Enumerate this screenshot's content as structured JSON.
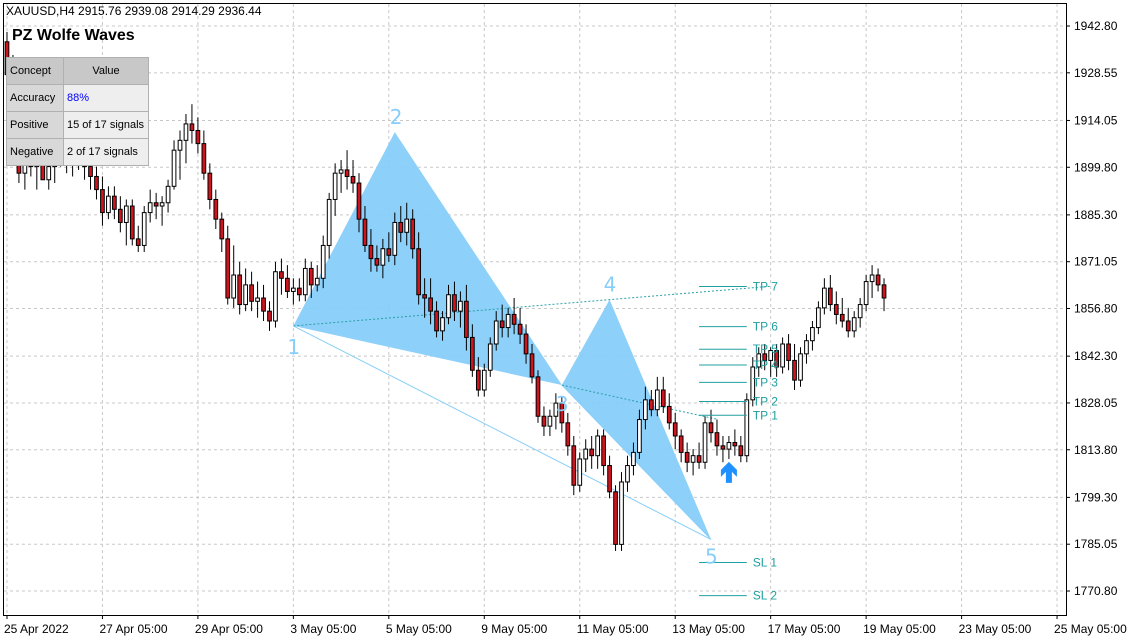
{
  "symbol_header": "XAUUSD,H4  2915.76 2939.08 2914.29 2936.44",
  "panel": {
    "title": "PZ Wolfe Waves",
    "headers": [
      "Concept",
      "Value"
    ],
    "rows": [
      {
        "concept": "Accuracy",
        "value": "88%"
      },
      {
        "concept": "Positive",
        "value": "15 of 17 signals"
      },
      {
        "concept": "Negative",
        "value": "2 of 17 signals"
      }
    ]
  },
  "colors": {
    "bull_candle": "#000000",
    "bear_candle": "#d0141e",
    "wave_fill": "#87cefa",
    "wave_label": "#87cefa",
    "target_line": "#20a0a0",
    "arrow": "#1e90ff",
    "grid": "#c8c8c8"
  },
  "chart_data": {
    "type": "candlestick",
    "ylim": [
      1763.5,
      1949.5
    ],
    "y_ticks": [
      "1942.80",
      "1928.55",
      "1914.05",
      "1899.80",
      "1885.30",
      "1871.05",
      "1856.80",
      "1842.30",
      "1828.05",
      "1813.80",
      "1799.30",
      "1785.05",
      "1770.80"
    ],
    "y_tick_values": [
      1942.8,
      1928.55,
      1914.05,
      1899.8,
      1885.3,
      1871.05,
      1856.8,
      1842.3,
      1828.05,
      1813.8,
      1799.3,
      1785.05,
      1770.8
    ],
    "x_ticks": [
      "25 Apr 2022",
      "27 Apr 05:00",
      "29 Apr 05:00",
      "3 May 05:00",
      "5 May 05:00",
      "9 May 05:00",
      "11 May 05:00",
      "13 May 05:00",
      "17 May 05:00",
      "19 May 05:00",
      "23 May 05:00",
      "25 May 05:00"
    ],
    "x_tick_bars": [
      0,
      16,
      32,
      48,
      64,
      80,
      96,
      112,
      128,
      144,
      160,
      176
    ],
    "bar_count": 178,
    "candles": [
      [
        1938,
        1941,
        1925,
        1928
      ],
      [
        1928,
        1934,
        1920,
        1930
      ],
      [
        1930,
        1932,
        1895,
        1898
      ],
      [
        1898,
        1906,
        1893,
        1902
      ],
      [
        1902,
        1909,
        1897,
        1900
      ],
      [
        1900,
        1905,
        1893,
        1904
      ],
      [
        1904,
        1910,
        1899,
        1896
      ],
      [
        1896,
        1903,
        1893,
        1900
      ],
      [
        1900,
        1907,
        1895,
        1905
      ],
      [
        1905,
        1908,
        1900,
        1903
      ],
      [
        1903,
        1907,
        1898,
        1901
      ],
      [
        1901,
        1906,
        1897,
        1905
      ],
      [
        1905,
        1910,
        1899,
        1902
      ],
      [
        1902,
        1906,
        1896,
        1900
      ],
      [
        1900,
        1903,
        1893,
        1897
      ],
      [
        1897,
        1900,
        1890,
        1893
      ],
      [
        1893,
        1897,
        1882,
        1886
      ],
      [
        1886,
        1894,
        1884,
        1891
      ],
      [
        1891,
        1894,
        1884,
        1887
      ],
      [
        1887,
        1891,
        1880,
        1883
      ],
      [
        1883,
        1890,
        1876,
        1888
      ],
      [
        1888,
        1890,
        1876,
        1878
      ],
      [
        1878,
        1882,
        1874,
        1876
      ],
      [
        1876,
        1888,
        1874,
        1886
      ],
      [
        1886,
        1893,
        1883,
        1889
      ],
      [
        1889,
        1892,
        1884,
        1888
      ],
      [
        1888,
        1891,
        1882,
        1889
      ],
      [
        1889,
        1896,
        1886,
        1894
      ],
      [
        1894,
        1908,
        1893,
        1905
      ],
      [
        1905,
        1911,
        1896,
        1908
      ],
      [
        1908,
        1916,
        1901,
        1913
      ],
      [
        1913,
        1919,
        1907,
        1911
      ],
      [
        1911,
        1915,
        1904,
        1907
      ],
      [
        1907,
        1911,
        1896,
        1898
      ],
      [
        1898,
        1901,
        1887,
        1890
      ],
      [
        1890,
        1893,
        1881,
        1884
      ],
      [
        1884,
        1886,
        1874,
        1878
      ],
      [
        1878,
        1882,
        1858,
        1860
      ],
      [
        1860,
        1876,
        1857,
        1867
      ],
      [
        1867,
        1871,
        1855,
        1858
      ],
      [
        1858,
        1869,
        1856,
        1864
      ],
      [
        1864,
        1868,
        1856,
        1859
      ],
      [
        1859,
        1865,
        1854,
        1860
      ],
      [
        1860,
        1864,
        1853,
        1856
      ],
      [
        1856,
        1859,
        1850,
        1853
      ],
      [
        1853,
        1871,
        1851,
        1868
      ],
      [
        1868,
        1872,
        1861,
        1866
      ],
      [
        1866,
        1870,
        1860,
        1862
      ],
      [
        1862,
        1866,
        1858,
        1863
      ],
      [
        1863,
        1866,
        1859,
        1861
      ],
      [
        1861,
        1872,
        1859,
        1869
      ],
      [
        1869,
        1871,
        1860,
        1864
      ],
      [
        1864,
        1870,
        1862,
        1866
      ],
      [
        1866,
        1879,
        1863,
        1876
      ],
      [
        1876,
        1892,
        1872,
        1890
      ],
      [
        1890,
        1901,
        1885,
        1898
      ],
      [
        1898,
        1902,
        1892,
        1899
      ],
      [
        1899,
        1905,
        1893,
        1897
      ],
      [
        1897,
        1902,
        1892,
        1895
      ],
      [
        1895,
        1898,
        1880,
        1884
      ],
      [
        1884,
        1888,
        1874,
        1876
      ],
      [
        1876,
        1881,
        1868,
        1872
      ],
      [
        1872,
        1876,
        1868,
        1870
      ],
      [
        1870,
        1878,
        1866,
        1875
      ],
      [
        1875,
        1880,
        1871,
        1873
      ],
      [
        1873,
        1886,
        1870,
        1883
      ],
      [
        1883,
        1888,
        1877,
        1880
      ],
      [
        1880,
        1889,
        1876,
        1884
      ],
      [
        1884,
        1887,
        1872,
        1875
      ],
      [
        1875,
        1880,
        1858,
        1861
      ],
      [
        1861,
        1866,
        1854,
        1860
      ],
      [
        1860,
        1866,
        1852,
        1856
      ],
      [
        1856,
        1859,
        1848,
        1850
      ],
      [
        1850,
        1856,
        1847,
        1854
      ],
      [
        1854,
        1864,
        1852,
        1861
      ],
      [
        1861,
        1865,
        1853,
        1856
      ],
      [
        1856,
        1862,
        1851,
        1859
      ],
      [
        1859,
        1864,
        1844,
        1848
      ],
      [
        1848,
        1852,
        1836,
        1838
      ],
      [
        1838,
        1842,
        1830,
        1832
      ],
      [
        1832,
        1840,
        1830,
        1838
      ],
      [
        1838,
        1848,
        1836,
        1846
      ],
      [
        1846,
        1856,
        1844,
        1853
      ],
      [
        1853,
        1858,
        1848,
        1851
      ],
      [
        1851,
        1857,
        1848,
        1855
      ],
      [
        1855,
        1860,
        1849,
        1852
      ],
      [
        1852,
        1857,
        1846,
        1849
      ],
      [
        1849,
        1852,
        1840,
        1843
      ],
      [
        1843,
        1846,
        1834,
        1836
      ],
      [
        1836,
        1838,
        1822,
        1824
      ],
      [
        1824,
        1827,
        1818,
        1821
      ],
      [
        1821,
        1826,
        1818,
        1824
      ],
      [
        1824,
        1831,
        1820,
        1828
      ],
      [
        1828,
        1830,
        1819,
        1822
      ],
      [
        1822,
        1825,
        1812,
        1815
      ],
      [
        1815,
        1818,
        1800,
        1803
      ],
      [
        1803,
        1813,
        1801,
        1811
      ],
      [
        1811,
        1817,
        1807,
        1814
      ],
      [
        1814,
        1818,
        1808,
        1812
      ],
      [
        1812,
        1820,
        1808,
        1818
      ],
      [
        1818,
        1820,
        1806,
        1809
      ],
      [
        1809,
        1812,
        1799,
        1801
      ],
      [
        1801,
        1803,
        1783,
        1785
      ],
      [
        1785,
        1807,
        1783,
        1804
      ],
      [
        1804,
        1812,
        1801,
        1809
      ],
      [
        1809,
        1816,
        1806,
        1813
      ],
      [
        1813,
        1826,
        1811,
        1823
      ],
      [
        1823,
        1833,
        1820,
        1829
      ],
      [
        1829,
        1832,
        1824,
        1826
      ],
      [
        1826,
        1836,
        1824,
        1832
      ],
      [
        1832,
        1836,
        1825,
        1827
      ],
      [
        1827,
        1831,
        1820,
        1822
      ],
      [
        1822,
        1825,
        1814,
        1818
      ],
      [
        1818,
        1820,
        1810,
        1813
      ],
      [
        1813,
        1816,
        1807,
        1810
      ],
      [
        1810,
        1814,
        1806,
        1812
      ],
      [
        1812,
        1816,
        1808,
        1810
      ],
      [
        1810,
        1824,
        1808,
        1822
      ],
      [
        1822,
        1826,
        1816,
        1819
      ],
      [
        1819,
        1823,
        1812,
        1815
      ],
      [
        1815,
        1818,
        1810,
        1814
      ],
      [
        1814,
        1818,
        1811,
        1816
      ],
      [
        1816,
        1820,
        1812,
        1815
      ],
      [
        1815,
        1818,
        1810,
        1812
      ],
      [
        1812,
        1831,
        1810,
        1829
      ],
      [
        1829,
        1842,
        1827,
        1839
      ],
      [
        1839,
        1845,
        1836,
        1843
      ],
      [
        1843,
        1846,
        1838,
        1841
      ],
      [
        1841,
        1845,
        1836,
        1844
      ],
      [
        1844,
        1846,
        1836,
        1839
      ],
      [
        1839,
        1848,
        1837,
        1846
      ],
      [
        1846,
        1849,
        1838,
        1841
      ],
      [
        1841,
        1846,
        1832,
        1835
      ],
      [
        1835,
        1845,
        1833,
        1843
      ],
      [
        1843,
        1849,
        1840,
        1847
      ],
      [
        1847,
        1853,
        1844,
        1851
      ],
      [
        1851,
        1859,
        1849,
        1857
      ],
      [
        1857,
        1866,
        1855,
        1863
      ],
      [
        1863,
        1867,
        1856,
        1858
      ],
      [
        1858,
        1862,
        1852,
        1855
      ],
      [
        1855,
        1860,
        1851,
        1853
      ],
      [
        1853,
        1857,
        1848,
        1850
      ],
      [
        1850,
        1856,
        1848,
        1854
      ],
      [
        1854,
        1860,
        1851,
        1858
      ],
      [
        1858,
        1867,
        1856,
        1865
      ],
      [
        1865,
        1870,
        1860,
        1867
      ],
      [
        1867,
        1869,
        1862,
        1864
      ],
      [
        1864,
        1866,
        1856,
        1860
      ]
    ],
    "wave_points": [
      {
        "label": "1",
        "bar": 48,
        "price": 1851.5
      },
      {
        "label": "2",
        "bar": 65,
        "price": 1910.5
      },
      {
        "label": "3",
        "bar": 93,
        "price": 1833.5
      },
      {
        "label": "4",
        "bar": 101,
        "price": 1859.5
      },
      {
        "label": "5",
        "bar": 118,
        "price": 1786.5
      }
    ],
    "targets": [
      {
        "label": "TP 7",
        "price": 1863.5
      },
      {
        "label": "TP 6",
        "price": 1851.3
      },
      {
        "label": "TP 5",
        "price": 1844.4
      },
      {
        "label": "TP 4",
        "price": 1839.6
      },
      {
        "label": "TP 3",
        "price": 1834.3
      },
      {
        "label": "TP 2",
        "price": 1828.5
      },
      {
        "label": "TP 1",
        "price": 1824.3
      },
      {
        "label": "SL 1",
        "price": 1779.5
      },
      {
        "label": "SL 2",
        "price": 1769.4
      }
    ]
  }
}
